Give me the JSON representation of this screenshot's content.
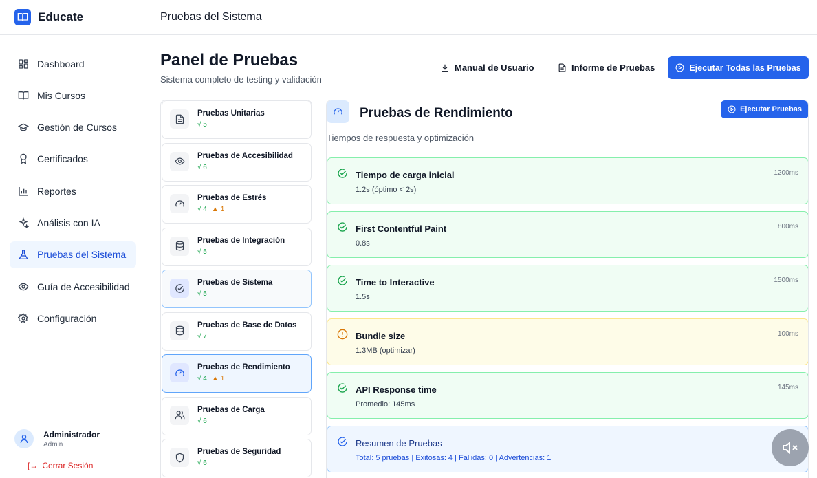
{
  "app": {
    "name": "Educate",
    "logo_icon": "book-open-icon"
  },
  "sidebar": {
    "items": [
      {
        "label": "Dashboard",
        "icon": "layout-grid-icon",
        "active": false
      },
      {
        "label": "Mis Cursos",
        "icon": "book-open-icon",
        "active": false
      },
      {
        "label": "Gestión de Cursos",
        "icon": "graduation-cap-icon",
        "active": false
      },
      {
        "label": "Certificados",
        "icon": "award-icon",
        "active": false
      },
      {
        "label": "Reportes",
        "icon": "bar-chart-icon",
        "active": false
      },
      {
        "label": "Análisis con IA",
        "icon": "sparkles-icon",
        "active": false
      },
      {
        "label": "Pruebas del Sistema",
        "icon": "flask-icon",
        "active": true
      },
      {
        "label": "Guía de Accesibilidad",
        "icon": "eye-icon",
        "active": false
      },
      {
        "label": "Configuración",
        "icon": "settings-icon",
        "active": false
      }
    ],
    "user": {
      "name": "Administrador",
      "role": "Admin",
      "logout_label": "Cerrar Sesión"
    }
  },
  "header": {
    "title": "Pruebas del Sistema"
  },
  "page": {
    "title": "Panel de Pruebas",
    "subtitle": "Sistema completo de testing y validación",
    "buttons": {
      "manual": "Manual de Usuario",
      "informe": "Informe de Pruebas",
      "run_all": "Ejecutar Todas las Pruebas"
    }
  },
  "categories": [
    {
      "name": "Pruebas Unitarias",
      "passed": "√ 5",
      "warnings": "",
      "icon": "file-text-icon",
      "state": "normal"
    },
    {
      "name": "Pruebas de Accesibilidad",
      "passed": "√ 6",
      "warnings": "",
      "icon": "eye-icon",
      "state": "normal"
    },
    {
      "name": "Pruebas de Estrés",
      "passed": "√ 4",
      "warnings": "1",
      "icon": "gauge-icon",
      "state": "normal"
    },
    {
      "name": "Pruebas de Integración",
      "passed": "√ 5",
      "warnings": "",
      "icon": "database-icon",
      "state": "normal"
    },
    {
      "name": "Pruebas de Sistema",
      "passed": "√ 5",
      "warnings": "",
      "icon": "check-circle-icon",
      "state": "selected"
    },
    {
      "name": "Pruebas de Base de Datos",
      "passed": "√ 7",
      "warnings": "",
      "icon": "database-icon",
      "state": "normal"
    },
    {
      "name": "Pruebas de Rendimiento",
      "passed": "√ 4",
      "warnings": "1",
      "icon": "gauge-icon",
      "state": "current"
    },
    {
      "name": "Pruebas de Carga",
      "passed": "√ 6",
      "warnings": "",
      "icon": "users-icon",
      "state": "normal"
    },
    {
      "name": "Pruebas de Seguridad",
      "passed": "√ 6",
      "warnings": "",
      "icon": "shield-icon",
      "state": "normal"
    }
  ],
  "detail": {
    "title": "Pruebas de Rendimiento",
    "subtitle": "Tiempos de respuesta y optimización",
    "run_label": "Ejecutar Pruebas",
    "results": [
      {
        "title": "Tiempo de carga inicial",
        "detail": "1.2s (óptimo < 2s)",
        "time": "1200ms",
        "status": "pass"
      },
      {
        "title": "First Contentful Paint",
        "detail": "0.8s",
        "time": "800ms",
        "status": "pass"
      },
      {
        "title": "Time to Interactive",
        "detail": "1.5s",
        "time": "1500ms",
        "status": "pass"
      },
      {
        "title": "Bundle size",
        "detail": "1.3MB (optimizar)",
        "time": "100ms",
        "status": "warning"
      },
      {
        "title": "API Response time",
        "detail": "Promedio: 145ms",
        "time": "145ms",
        "status": "pass"
      }
    ],
    "summary": {
      "title": "Resumen de Pruebas",
      "detail": "Total: 5 pruebas | Exitosas: 4 | Fallidas: 0 | Advertencias: 1"
    }
  },
  "colors": {
    "primary": "#2563eb",
    "success": "#16a34a",
    "warning": "#d97706",
    "danger": "#dc2626"
  }
}
